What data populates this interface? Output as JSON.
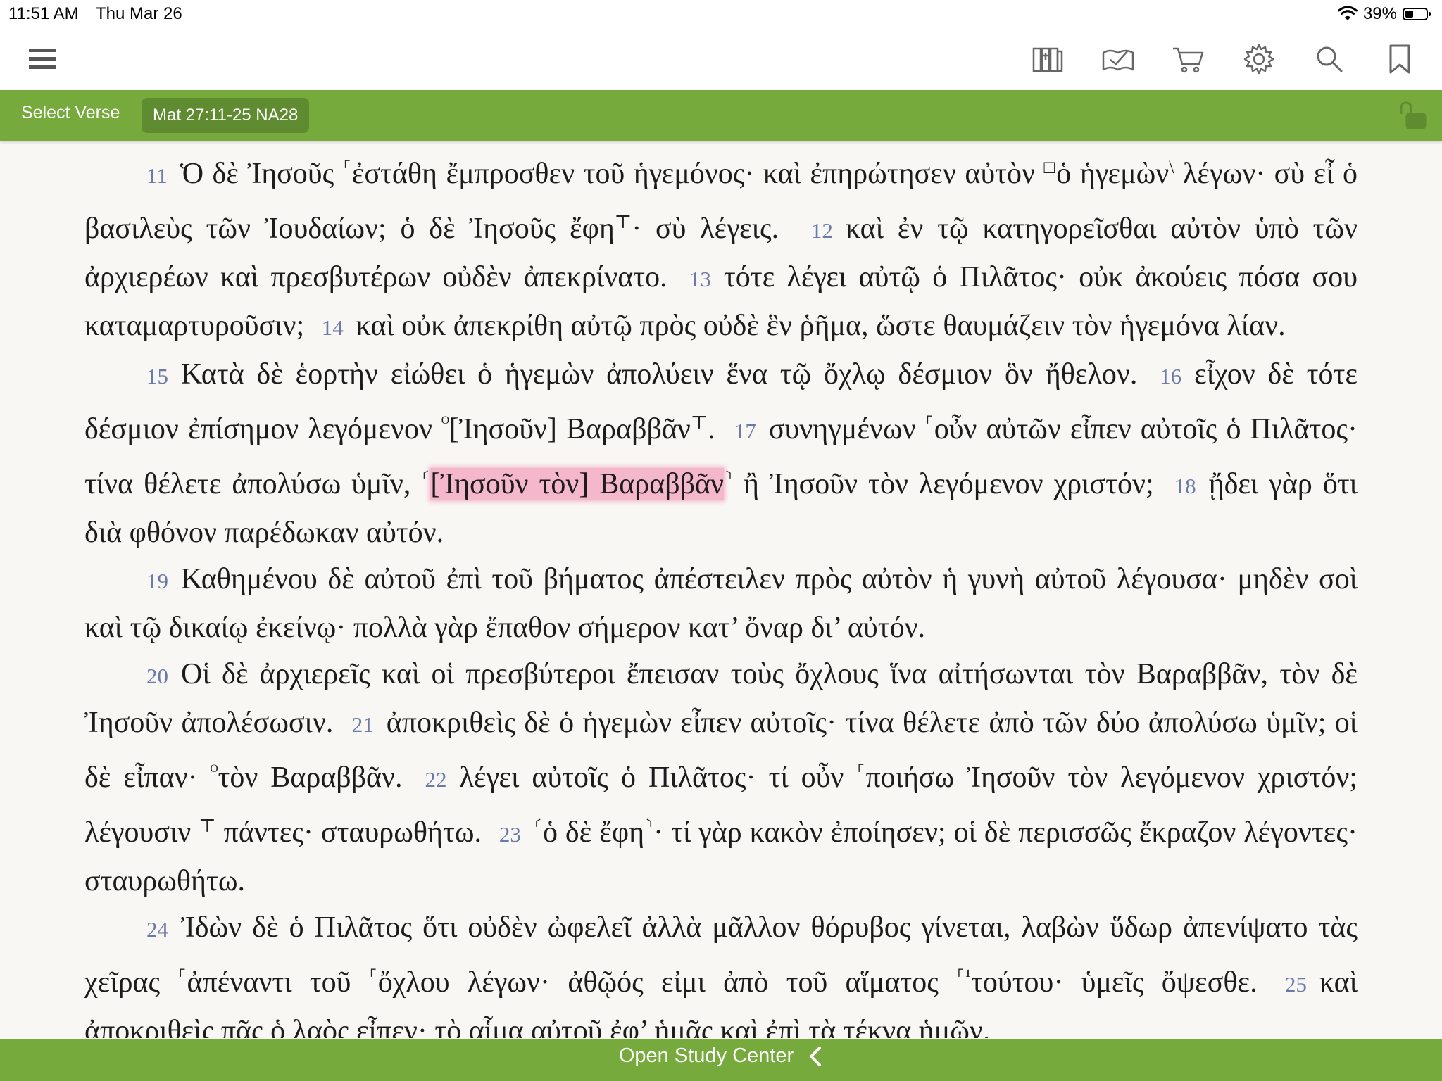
{
  "status": {
    "time": "11:51 AM",
    "date": "Thu Mar 26",
    "battery": "39%",
    "battery_level": 0.39
  },
  "toolbar": {
    "icons": [
      "menu-icon",
      "library-icon",
      "reading-plan-icon",
      "cart-icon",
      "settings-icon",
      "search-icon",
      "bookmark-icon"
    ]
  },
  "verse_bar": {
    "select_label": "Select Verse",
    "reference": "Mat 27:11-25 NA28",
    "lock": "unlocked"
  },
  "bottom_bar": {
    "label": "Open Study Center"
  },
  "colors": {
    "accent": "#77aa3d",
    "highlight": "#f5b7cc",
    "verse_number": "#6b7aa8"
  },
  "text": {
    "p1": {
      "v11": "11",
      "t11a": "Ὁ δὲ Ἰησοῦς ",
      "m11a": "⸀",
      "t11b": "ἐστάθη ἔμπροσθεν τοῦ ἡγεμόνος· καὶ ἐπηρώτησεν αὐτὸν ",
      "m11b": "□",
      "t11c": "ὁ ἡγεμὼν",
      "m11c": "\\",
      "t11d": " λέγων· σὺ εἶ ὁ βασιλεὺς τῶν Ἰουδαίων; ὁ δὲ Ἰησοῦς ἔφη",
      "m11d": "⊤",
      "t11e": "· σὺ λέγεις.",
      "v12": "12",
      "t12": "καὶ ἐν τῷ κατηγορεῖσθαι αὐτὸν ὑπὸ τῶν ἀρχιερέων καὶ πρεσβυτέρων οὐδὲν ἀπεκρίνατο.",
      "v13": "13",
      "t13": "τότε λέγει αὐτῷ ὁ Πιλᾶτος· οὐκ ἀκούεις πόσα σου καταμαρτυροῦσιν;",
      "v14": "14",
      "t14": "καὶ οὐκ ἀπεκρίθη αὐτῷ πρὸς οὐδὲ ἓν ῥῆμα, ὥστε θαυμάζειν τὸν ἡγεμόνα λίαν."
    },
    "p2": {
      "v15": "15",
      "t15": "Κατὰ δὲ ἑορτὴν εἰώθει ὁ ἡγεμὼν ἀπολύειν ἕνα τῷ ὄχλῳ δέσμιον ὃν ἤθελον.",
      "v16": "16",
      "t16a": "εἶχον δὲ τότε δέσμιον ἐπίσημον λεγόμενον ",
      "m16a": "ᴼ",
      "t16b": "[Ἰησοῦν] Βαραββᾶν",
      "m16b": "⊤",
      "t16c": ".",
      "v17": "17",
      "t17a": "συνηγμένων ",
      "m17a": "⸀",
      "t17b": "οὖν αὐτῶν εἶπεν αὐτοῖς ὁ Πιλᾶτος· τίνα θέλετε ἀπολύσω ὑμῖν, ",
      "m17b": "⸂",
      "t17hl": "[Ἰησοῦν τὸν] Βαραββᾶν",
      "m17c": "⸃",
      "t17c": " ἢ Ἰησοῦν τὸν λεγόμενον χριστόν;",
      "v18": "18",
      "t18": "ᾔδει γὰρ ὅτι διὰ φθόνον παρέδωκαν αὐτόν."
    },
    "p3": {
      "v19": "19",
      "t19": "Καθημένου δὲ αὐτοῦ ἐπὶ τοῦ βήματος ἀπέστειλεν πρὸς αὐτὸν ἡ γυνὴ αὐτοῦ λέγουσα· μηδὲν σοὶ καὶ τῷ δικαίῳ ἐκείνῳ· πολλὰ γὰρ ἔπαθον σήμερον κατ’ ὄναρ δι’ αὐτόν."
    },
    "p4": {
      "v20": "20",
      "t20": "Οἱ δὲ ἀρχιερεῖς καὶ οἱ πρεσβύτεροι ἔπεισαν τοὺς ὄχλους ἵνα αἰτήσωνται τὸν Βαραββᾶν, τὸν δὲ Ἰησοῦν ἀπολέσωσιν.",
      "v21": "21",
      "t21a": "ἀποκριθεὶς δὲ ὁ ἡγεμὼν εἶπεν αὐτοῖς· τίνα θέλετε ἀπὸ τῶν δύο ἀπολύσω ὑμῖν; οἱ δὲ εἶπαν· ",
      "m21a": "ᴼ",
      "t21b": "τὸν Βαραββᾶν.",
      "v22": "22",
      "t22a": "λέγει αὐτοῖς ὁ Πιλᾶτος· τί οὖν ",
      "m22a": "⸀",
      "t22b": "ποιήσω Ἰησοῦν τὸν λεγόμενον χριστόν; λέγουσιν ",
      "m22b": "⊤",
      "t22c": " πάντες· σταυρωθήτω.",
      "v23": "23",
      "m23a": "⸂",
      "t23a": "ὁ δὲ ἔφη",
      "m23b": "⸃",
      "t23b": "· τί γὰρ κακὸν ἐποίησεν; οἱ δὲ περισσῶς ἔκραζον λέγοντες· σταυρωθήτω."
    },
    "p5": {
      "v24": "24",
      "t24a": "Ἰδὼν δὲ ὁ Πιλᾶτος ὅτι οὐδὲν ὠφελεῖ ἀλλὰ μᾶλλον θόρυβος γίνεται, λαβὼν ὕδωρ ἀπενίψατο τὰς χεῖρας ",
      "m24a": "⸀",
      "t24b": "ἀπέναντι τοῦ ",
      "m24b": "⸀",
      "t24c": "ὄχλου λέγων· ἀθῷός εἰμι ἀπὸ τοῦ αἵματος ",
      "m24c": "⸀¹",
      "t24d": "τούτου· ὑμεῖς ὄψεσθε.",
      "v25": "25",
      "t25": "καὶ ἀποκριθεὶς πᾶς ὁ λαὸς εἶπεν· τὸ αἷμα αὐτοῦ ἐφ’ ἡμᾶς καὶ ἐπὶ τὰ τέκνα ἡμῶν."
    }
  }
}
